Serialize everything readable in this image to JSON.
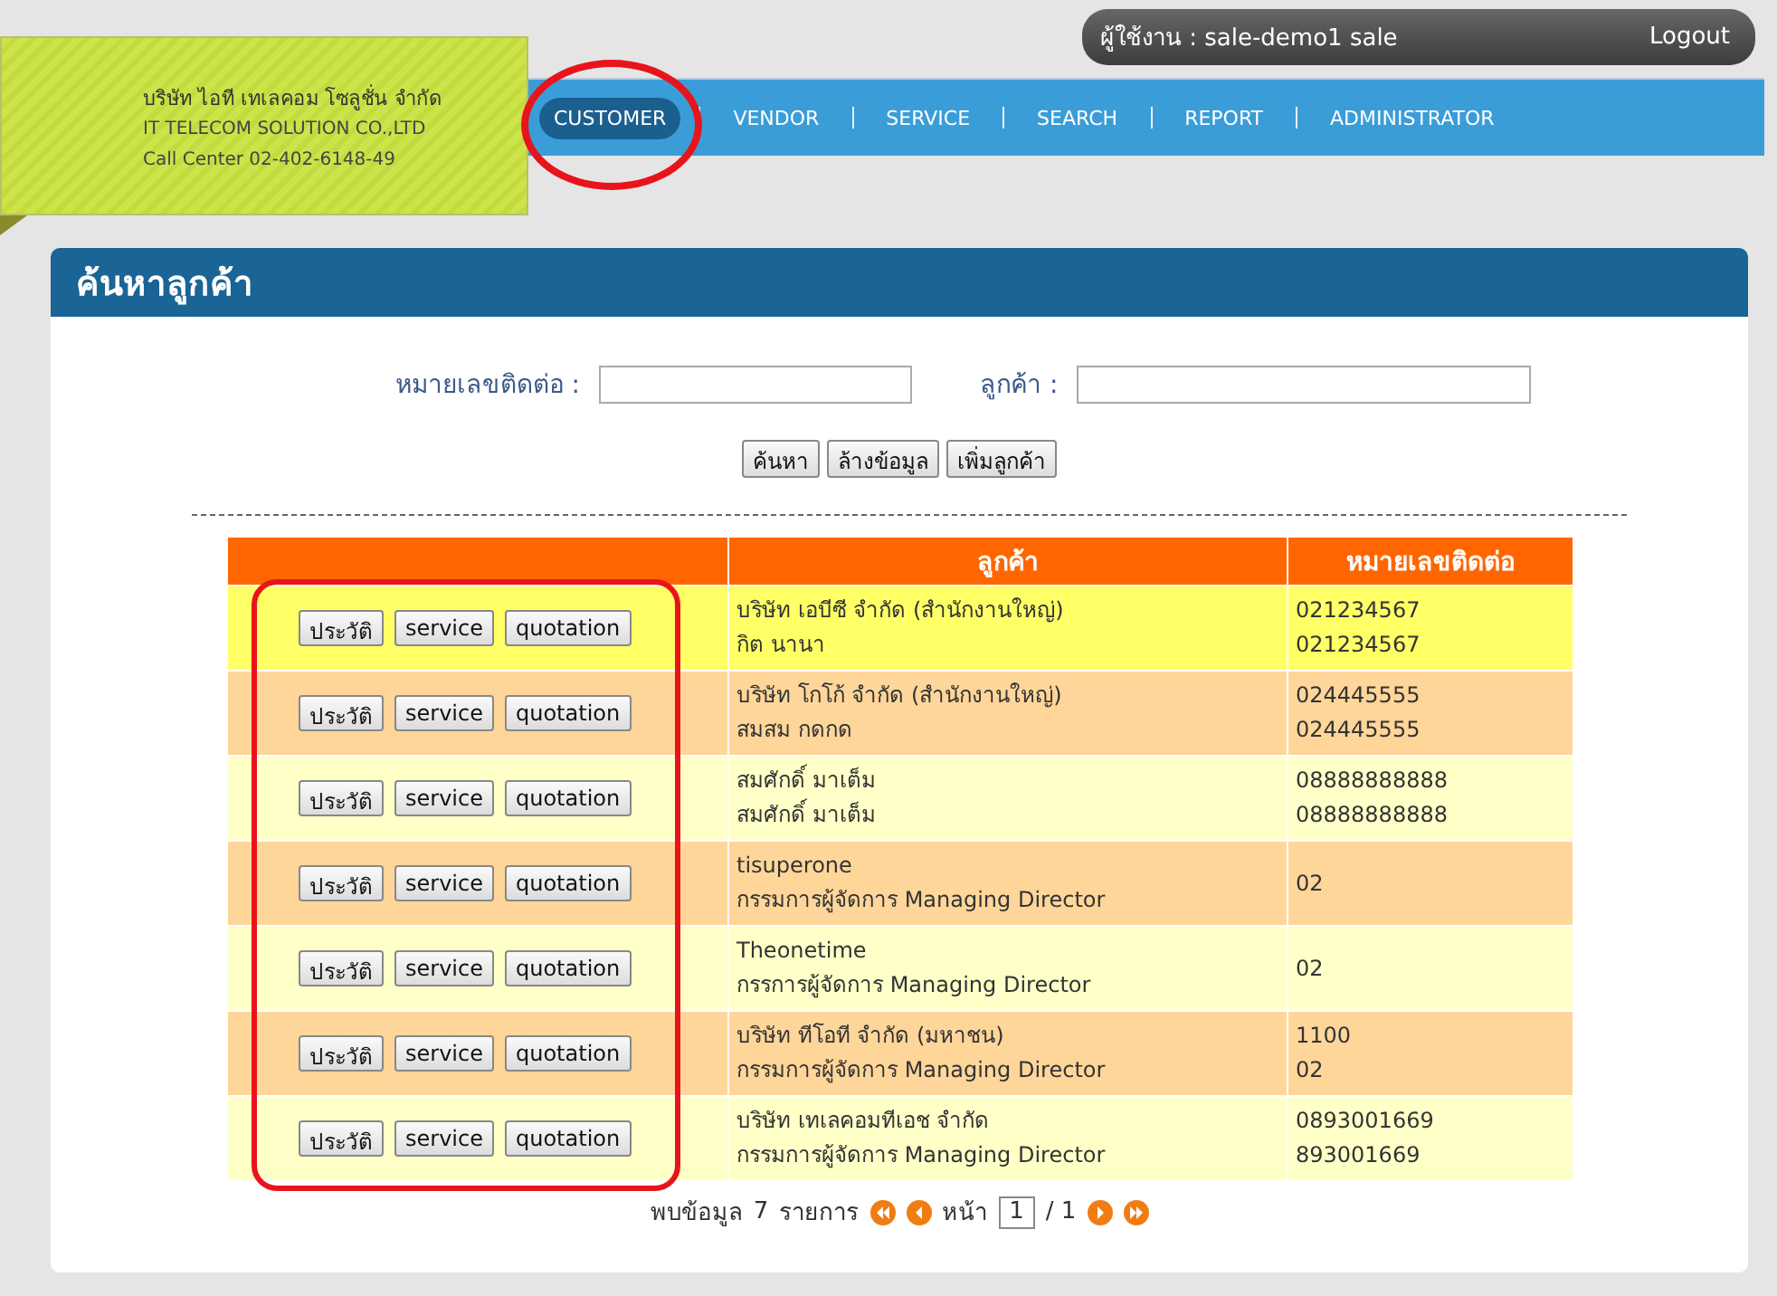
{
  "company": {
    "name_th": "บริษัท ไอที เทเลคอม โซลูชั่น จำกัด",
    "name_en": "IT TELECOM SOLUTION CO.,LTD",
    "call_center": "Call Center 02-402-6148-49"
  },
  "user_bar": {
    "user": "ผู้ใช้งาน : sale-demo1 sale",
    "logout": "Logout"
  },
  "nav": [
    {
      "label": "CUSTOMER",
      "selected": true
    },
    {
      "label": "VENDOR",
      "selected": false
    },
    {
      "label": "SERVICE",
      "selected": false
    },
    {
      "label": "SEARCH",
      "selected": false
    },
    {
      "label": "REPORT",
      "selected": false
    },
    {
      "label": "ADMINISTRATOR",
      "selected": false
    }
  ],
  "panel": {
    "title": "ค้นหาลูกค้า",
    "filters": [
      {
        "label": "หมายเลขติดต่อ :"
      },
      {
        "label": "ลูกค้า :"
      }
    ],
    "buttons": [
      "ค้นหา",
      "ล้างข้อมูล",
      "เพิ่มลูกค้า"
    ],
    "table": {
      "columns": [
        "ลูกค้า",
        "หมายเลขติดต่อ"
      ],
      "rows": [
        {
          "selected": true,
          "buttons": [
            "ประวัติ",
            "service",
            "quotation"
          ],
          "customer": [
            "บริษัท เอบีซี จำกัด (สำนักงานใหญ่)",
            "กิต นานา"
          ],
          "phones": [
            "021234567",
            "021234567"
          ]
        },
        {
          "selected": false,
          "buttons": [
            "ประวัติ",
            "service",
            "quotation"
          ],
          "customer": [
            "บริษัท โกโก้ จำกัด (สำนักงานใหญ่)",
            "สมสม กดกด"
          ],
          "phones": [
            "024445555",
            "024445555"
          ]
        },
        {
          "selected": false,
          "buttons": [
            "ประวัติ",
            "service",
            "quotation"
          ],
          "customer": [
            "สมศักดิ์ มาเต็ม",
            "สมศักดิ์ มาเต็ม"
          ],
          "phones": [
            "08888888888",
            "08888888888"
          ]
        },
        {
          "selected": false,
          "buttons": [
            "ประวัติ",
            "service",
            "quotation"
          ],
          "customer": [
            "tisuperone",
            "กรรมการผู้จัดการ Managing Director"
          ],
          "phones": [
            "02"
          ]
        },
        {
          "selected": false,
          "buttons": [
            "ประวัติ",
            "service",
            "quotation"
          ],
          "customer": [
            "Theonetime",
            "กรรการผู้จัดการ Managing Director"
          ],
          "phones": [
            "02"
          ]
        },
        {
          "selected": false,
          "buttons": [
            "ประวัติ",
            "service",
            "quotation"
          ],
          "customer": [
            "บริษัท ทีโอที จำกัด (มหาชน)",
            "กรรมการผู้จัดการ Managing Director"
          ],
          "phones": [
            "1100",
            "02"
          ]
        },
        {
          "selected": false,
          "buttons": [
            "ประวัติ",
            "service",
            "quotation"
          ],
          "customer": [
            "บริษัท เทเลคอมทีเอช จำกัด",
            "กรรมการผู้จัดการ Managing Director"
          ],
          "phones": [
            "0893001669",
            "893001669"
          ]
        }
      ]
    },
    "pager": {
      "found": "พบข้อมูล",
      "count": "7",
      "unit": "รายการ",
      "page_label": "หน้า",
      "page": "1",
      "of": "/ 1"
    }
  }
}
